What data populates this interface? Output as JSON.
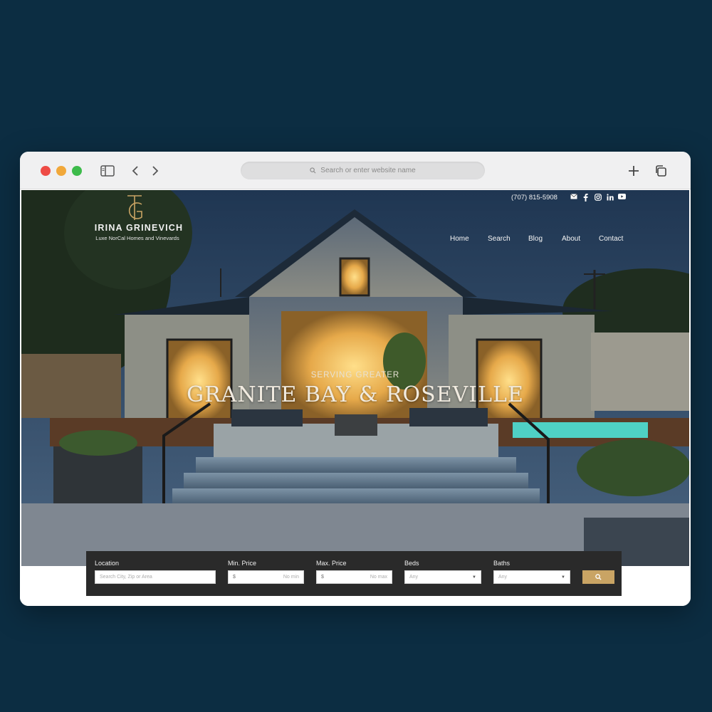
{
  "browser": {
    "address_placeholder": "Search or enter website name",
    "icons": [
      "sidebar-icon",
      "back-icon",
      "forward-icon",
      "search-icon",
      "new-tab-icon",
      "tabs-overview-icon"
    ]
  },
  "brand": {
    "name": "IRINA GRINEVICH",
    "tagline": "Luxe NorCal Homes and Vinevards",
    "accent_color": "#c9a464"
  },
  "contact": {
    "phone": "(707) 815-5908",
    "social_icons": [
      "email-icon",
      "facebook-icon",
      "instagram-icon",
      "linkedin-icon",
      "youtube-icon"
    ]
  },
  "nav": {
    "items": [
      {
        "label": "Home"
      },
      {
        "label": "Search"
      },
      {
        "label": "Blog"
      },
      {
        "label": "About"
      },
      {
        "label": "Contact"
      }
    ]
  },
  "hero": {
    "subtitle": "SERVING GREATER",
    "title": "GRANITE BAY & ROSEVILLE"
  },
  "search": {
    "location_label": "Location",
    "location_placeholder": "Search City, Zip or Area",
    "min_price_label": "Min. Price",
    "min_price_currency": "$",
    "min_price_placeholder": "No min",
    "max_price_label": "Max. Price",
    "max_price_currency": "$",
    "max_price_placeholder": "No max",
    "beds_label": "Beds",
    "beds_value": "Any",
    "baths_label": "Baths",
    "baths_value": "Any"
  }
}
